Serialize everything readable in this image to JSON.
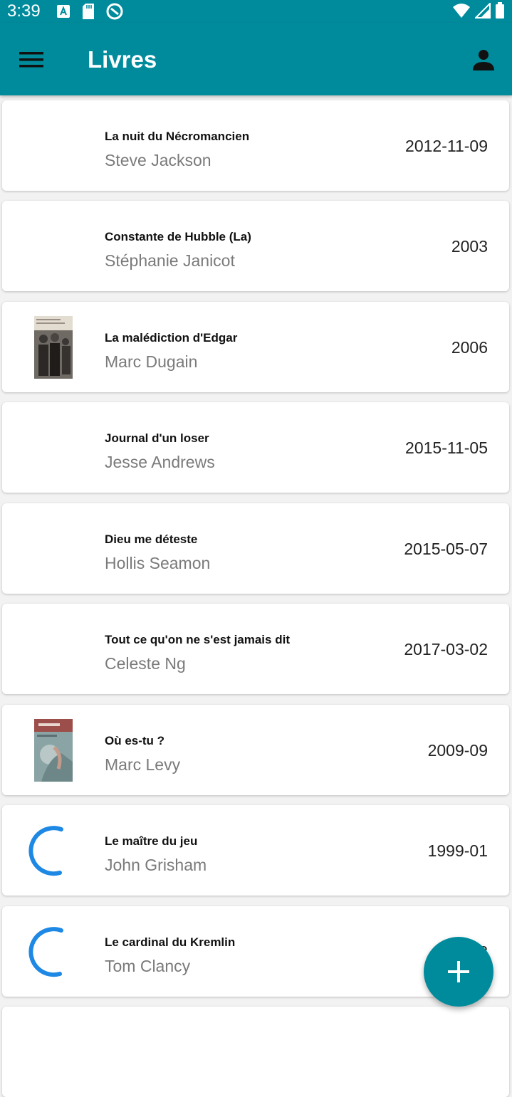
{
  "status": {
    "time": "3:39"
  },
  "appbar": {
    "title": "Livres"
  },
  "books": [
    {
      "title": "La nuit du Nécromancien",
      "author": "Steve Jackson",
      "date": "2012-11-09"
    },
    {
      "title": "Constante de Hubble (La)",
      "author": "Stéphanie Janicot",
      "date": "2003"
    },
    {
      "title": "La malédiction d'Edgar",
      "author": "Marc Dugain",
      "date": "2006"
    },
    {
      "title": "Journal d'un loser",
      "author": "Jesse Andrews",
      "date": "2015-11-05"
    },
    {
      "title": "Dieu me déteste",
      "author": "Hollis Seamon",
      "date": "2015-05-07"
    },
    {
      "title": "Tout ce qu'on ne s'est jamais dit",
      "author": "Celeste Ng",
      "date": "2017-03-02"
    },
    {
      "title": "Où es-tu ?",
      "author": "Marc Levy",
      "date": "2009-09"
    },
    {
      "title": "Le maître du jeu",
      "author": "John Grisham",
      "date": "1999-01"
    },
    {
      "title": "Le cardinal du Kremlin",
      "author": "Tom Clancy",
      "date": "1988"
    }
  ],
  "colors": {
    "primary": "#008b9c",
    "spinner": "#1e88e5"
  }
}
